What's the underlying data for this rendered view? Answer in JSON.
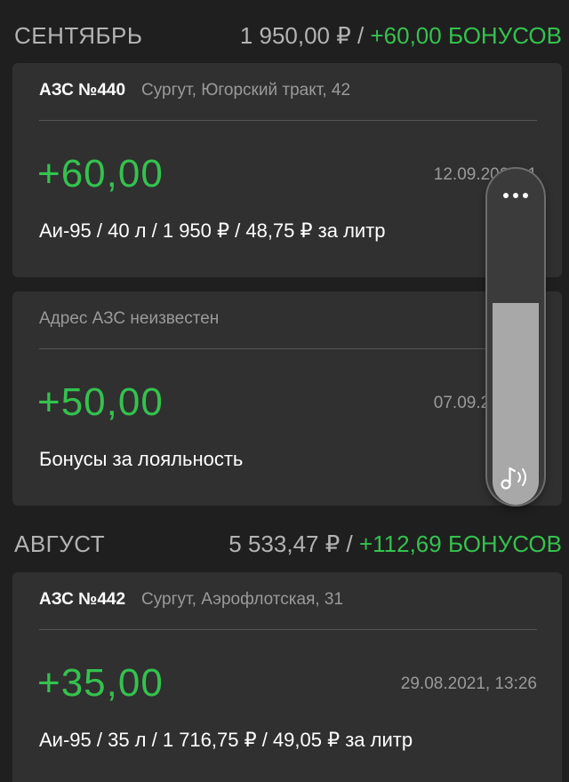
{
  "months": [
    {
      "name": "СЕНТЯБРЬ",
      "spent": "1 950,00 ₽",
      "separator": " / ",
      "bonus": "+60,00 БОНУСОВ"
    },
    {
      "name": "АВГУСТ",
      "spent": "5 533,47 ₽",
      "separator": " / ",
      "bonus": "+112,69 БОНУСОВ"
    }
  ],
  "transactions": [
    {
      "station": "АЗС №440",
      "address": "Сургут, Югорский тракт, 42",
      "amount": "+60,00",
      "date": "12.09.2021, 1",
      "details": "Аи-95 / 40 л / 1 950 ₽ / 48,75 ₽ за литр"
    },
    {
      "address_unknown": "Адрес АЗС неизвестен",
      "amount": "+50,00",
      "date": "07.09.2021, 1",
      "details": "Бонусы за лояльность"
    },
    {
      "station": "АЗС №442",
      "address": "Сургут, Аэрофлотская, 31",
      "amount": "+35,00",
      "date": "29.08.2021, 13:26",
      "details": "Аи-95 / 35 л / 1 716,75 ₽ / 49,05 ₽ за литр"
    }
  ],
  "volume_overlay": {
    "level": 0.6,
    "menu_icon": "more-dots-icon",
    "speaker_icon": "music-note-volume-icon"
  },
  "colors": {
    "background": "#1f1f1f",
    "card": "#303030",
    "bonus_green": "#34c24e",
    "muted_text": "#9a9a9a"
  }
}
